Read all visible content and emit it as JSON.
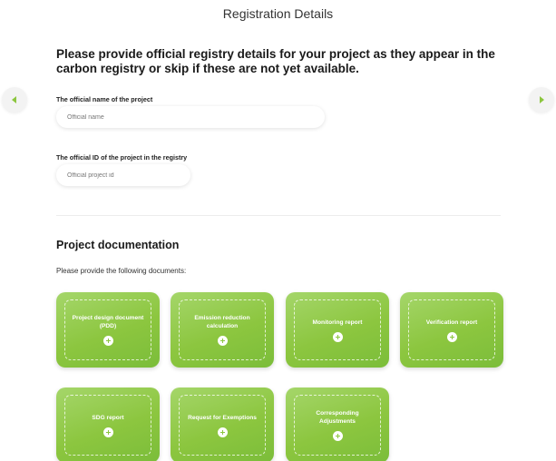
{
  "header": {
    "title": "Registration Details"
  },
  "navigation": {
    "prev_icon": "chevron-left-icon",
    "next_icon": "chevron-right-icon"
  },
  "registry": {
    "heading": "Please provide official registry details for your project as they appear in the carbon registry or skip if these are not yet available.",
    "name_label": "The official name of the project",
    "name_placeholder": "Official name",
    "name_value": "",
    "id_label": "The official ID of the project in the registry",
    "id_placeholder": "Official project id",
    "id_value": ""
  },
  "documentation": {
    "title": "Project documentation",
    "subtitle": "Please provide the following documents:",
    "cards": [
      {
        "label": "Project design document (PDD)"
      },
      {
        "label": "Emission reduction calculation"
      },
      {
        "label": "Monitoring report"
      },
      {
        "label": "Verification report"
      },
      {
        "label": "SDG report"
      },
      {
        "label": "Request for Exemptions"
      },
      {
        "label": "Corresponding Adjustments"
      }
    ]
  },
  "colors": {
    "accent": "#8cc63f",
    "accent_light": "#a5d66a",
    "text": "#1a1a1a"
  }
}
